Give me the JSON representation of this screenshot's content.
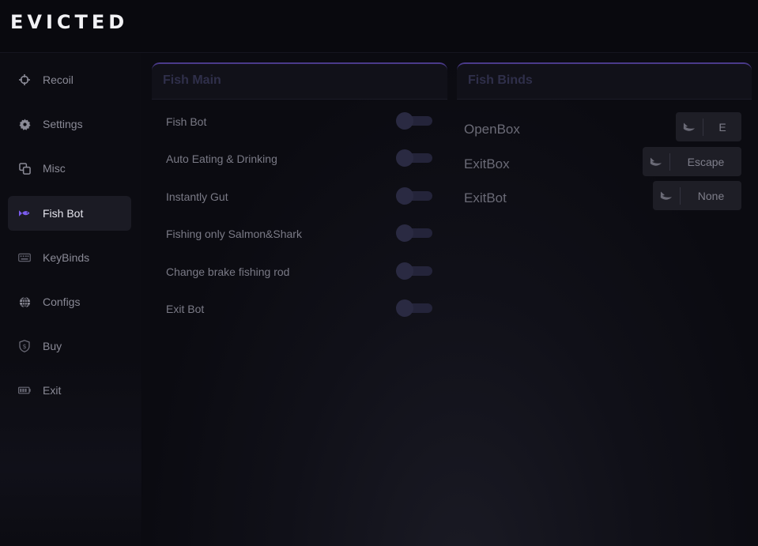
{
  "app": {
    "title": "EVICTED"
  },
  "sidebar": {
    "items": [
      {
        "label": "Recoil",
        "icon": "crosshair-icon",
        "active": false
      },
      {
        "label": "Settings",
        "icon": "gear-icon",
        "active": false
      },
      {
        "label": "Misc",
        "icon": "squares-icon",
        "active": false
      },
      {
        "label": "Fish Bot",
        "icon": "fish-icon",
        "active": true
      },
      {
        "label": "KeyBinds",
        "icon": "keyboard-icon",
        "active": false
      },
      {
        "label": "Configs",
        "icon": "globe-icon",
        "active": false
      },
      {
        "label": "Buy",
        "icon": "shield-dollar-icon",
        "active": false
      },
      {
        "label": "Exit",
        "icon": "battery-icon",
        "active": false
      }
    ]
  },
  "fish_main": {
    "title": "Fish Main",
    "rows": [
      {
        "label": "Fish Bot",
        "enabled": false
      },
      {
        "label": "Auto Eating & Drinking",
        "enabled": false
      },
      {
        "label": "Instantly Gut",
        "enabled": false
      },
      {
        "label": "Fishing only Salmon&Shark",
        "enabled": false
      },
      {
        "label": "Change brake fishing rod",
        "enabled": false
      },
      {
        "label": "Exit Bot",
        "enabled": false
      }
    ]
  },
  "fish_binds": {
    "title": "Fish Binds",
    "binds": [
      {
        "label": "OpenBox",
        "key": "E"
      },
      {
        "label": "ExitBox",
        "key": "Escape"
      },
      {
        "label": "ExitBot",
        "key": "None"
      }
    ]
  },
  "colors": {
    "accent": "#7b5cf0",
    "panel_border": "#4a3a8a",
    "background": "#0a0a10"
  }
}
